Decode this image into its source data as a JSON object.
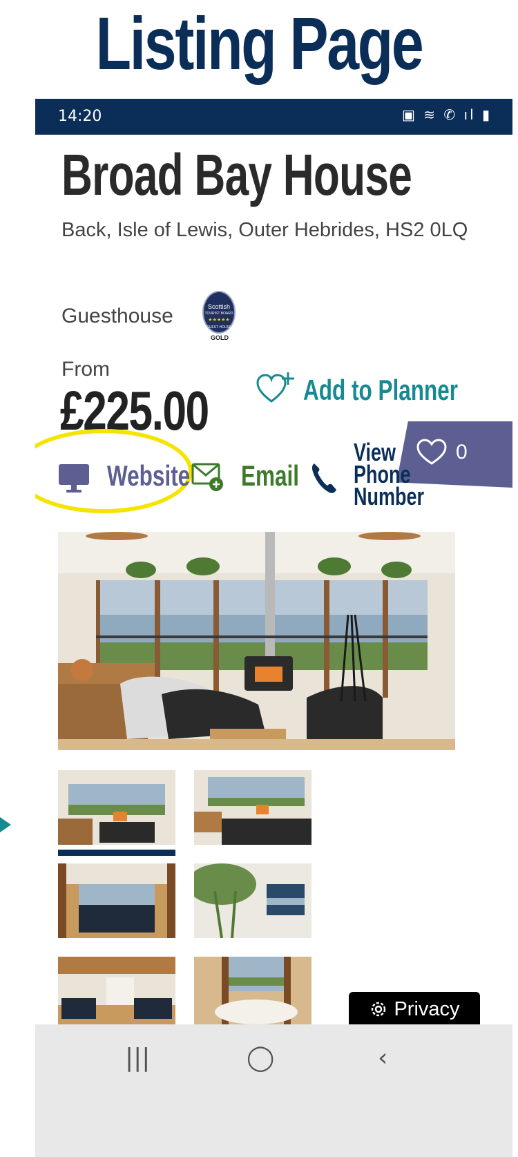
{
  "page_heading": "Listing Page",
  "status_bar": {
    "time": "14:20",
    "icons": "▣ ≋ ✆ ıl ▮"
  },
  "listing": {
    "name": "Broad Bay House",
    "address": "Back, Isle of Lewis, Outer Hebrides, HS2 0LQ",
    "category": "Guesthouse",
    "badge": {
      "line1": "Scottish",
      "line2": "TOURIST BOARD",
      "stars": "★★★★★",
      "line3": "GUEST HOUSE",
      "grade": "GOLD"
    },
    "price_prefix": "From",
    "price": "£225.00",
    "add_to_planner": "Add to Planner",
    "favourites_count": "0"
  },
  "actions": {
    "website": "Website",
    "email": "Email",
    "phone_line1": "View",
    "phone_line2": "Phone",
    "phone_line3": "Number"
  },
  "privacy_label": "Privacy",
  "nav": {
    "recents": "|||",
    "home": "◯",
    "back": "‹"
  },
  "colors": {
    "navy": "#0b2e59",
    "teal": "#168a93",
    "purple": "#5d5e92",
    "green": "#3d7a2a",
    "highlight": "#f5e400"
  },
  "icons": [
    "monitor-icon",
    "email-plus-icon",
    "phone-icon",
    "heart-plus-icon",
    "heart-icon",
    "gear-icon"
  ]
}
